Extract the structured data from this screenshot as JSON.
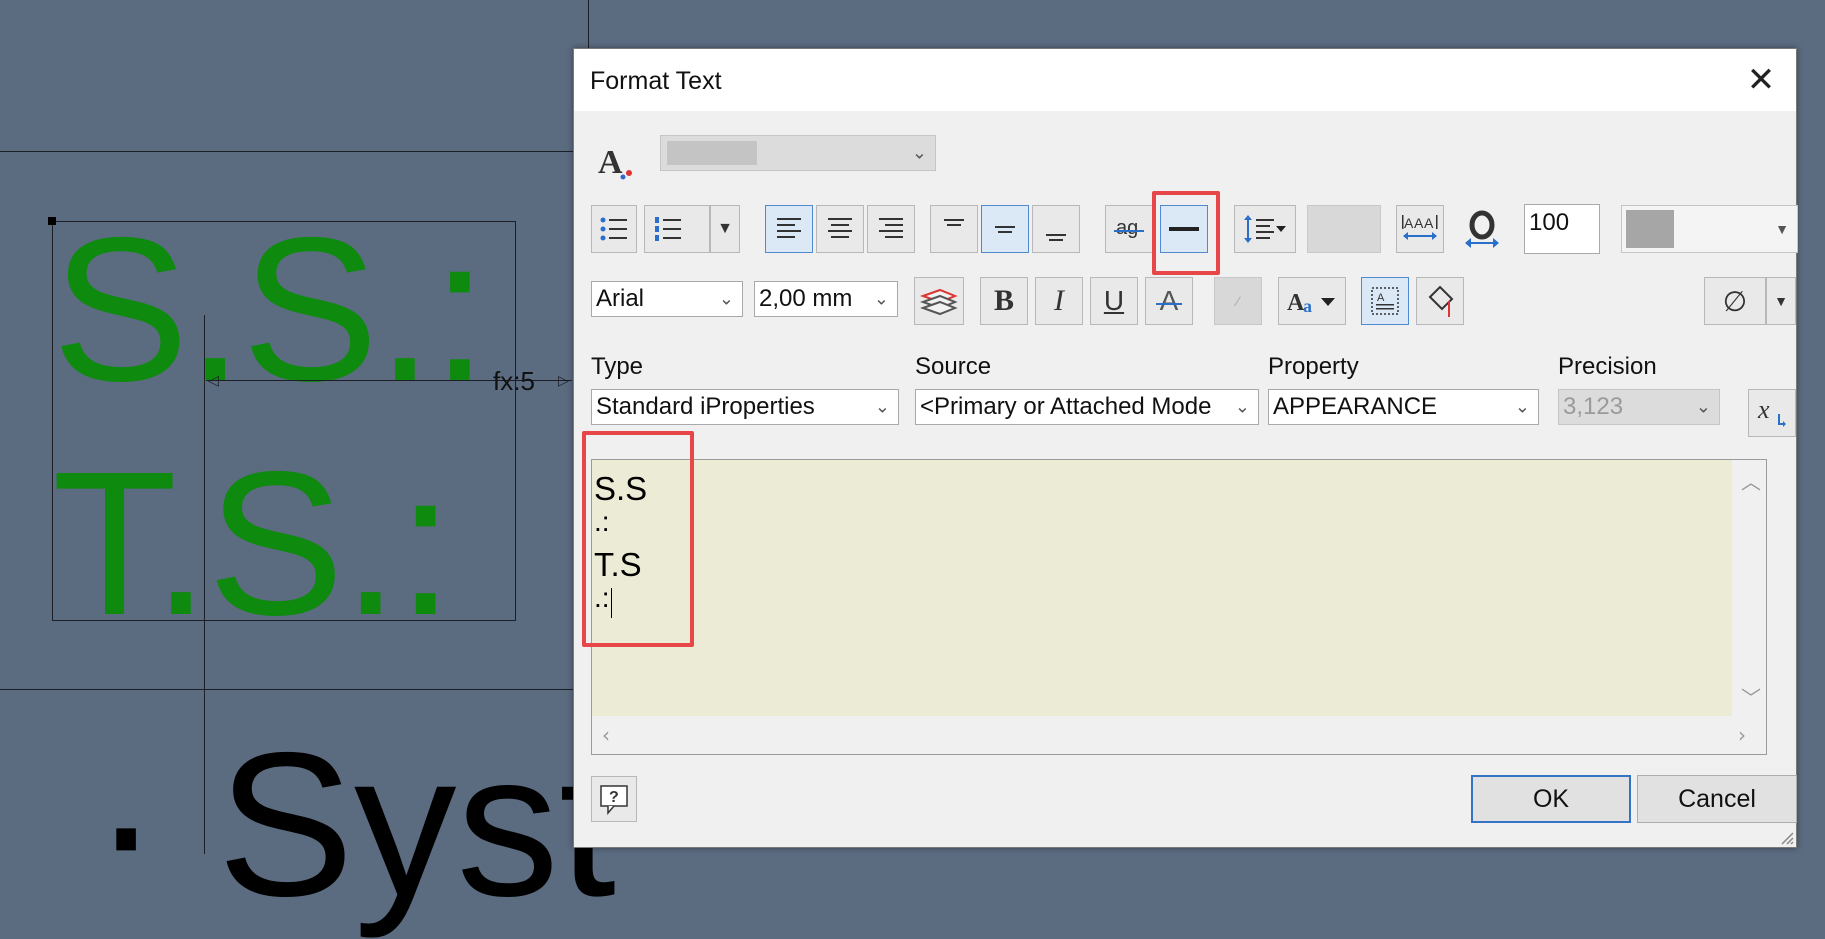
{
  "canvas": {
    "green_line_1": "S.S.:",
    "green_line_2": "T.S.:",
    "bottom_text": "· Syst",
    "dimension_label": "fx:5"
  },
  "dialog": {
    "title": "Format Text",
    "close_glyph": "✕",
    "style_combo_value": "",
    "width_factor_value": "100",
    "font_value": "Arial",
    "size_value": "2,00 mm",
    "labels": {
      "type": "Type",
      "source": "Source",
      "property": "Property",
      "precision": "Precision"
    },
    "type_value": "Standard iProperties",
    "source_value": "<Primary or Attached Mode",
    "property_value": "APPEARANCE",
    "precision_value": "3,123",
    "editor_lines": [
      "S.S",
      ".:",
      "T.S",
      ".:"
    ],
    "ok_label": "OK",
    "cancel_label": "Cancel",
    "symbol_glyph": "∅"
  },
  "colors": {
    "canvas_bg": "#5b6b80",
    "green_text": "#0e8a0e",
    "highlight": "#e8474a",
    "editor_bg": "#ecebd6"
  }
}
